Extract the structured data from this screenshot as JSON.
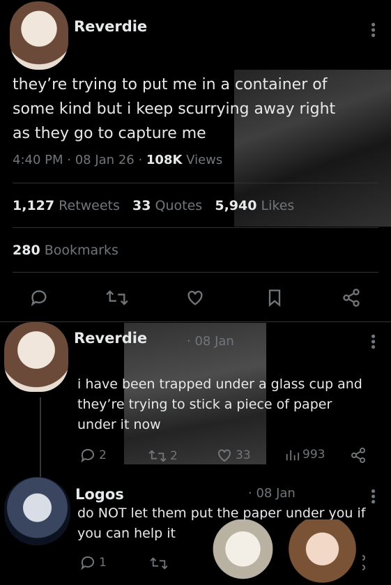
{
  "main_tweet": {
    "author": "Reverdie",
    "text_lines": [
      "they’re trying to put me in a container of",
      "some kind but i keep scurrying away right",
      "as they go to capture me"
    ],
    "time": "4:40 PM",
    "date": "08 Jan 26",
    "views_count": "108K",
    "views_label": "Views",
    "retweets_count": "1,127",
    "retweets_label": "Retweets",
    "quotes_count": "33",
    "quotes_label": "Quotes",
    "likes_count": "5,940",
    "likes_label": "Likes",
    "bookmarks_count": "280",
    "bookmarks_label": "Bookmarks"
  },
  "actions": [
    "reply-icon",
    "retweet-icon",
    "like-icon",
    "bookmark-icon",
    "share-icon"
  ],
  "reply1": {
    "author": "Reverdie",
    "date": "· 08 Jan",
    "text_lines": [
      "i have been trapped under a glass cup and",
      "they’re trying to stick a piece of paper",
      "under it now"
    ],
    "replies": "2",
    "retweets": "2",
    "likes": "33",
    "views": "993"
  },
  "reply2": {
    "author": "Logos",
    "date": "· 08 Jan",
    "text_lines": [
      "do NOT let them put the paper under you if",
      "you can help it"
    ],
    "replies": "1"
  }
}
